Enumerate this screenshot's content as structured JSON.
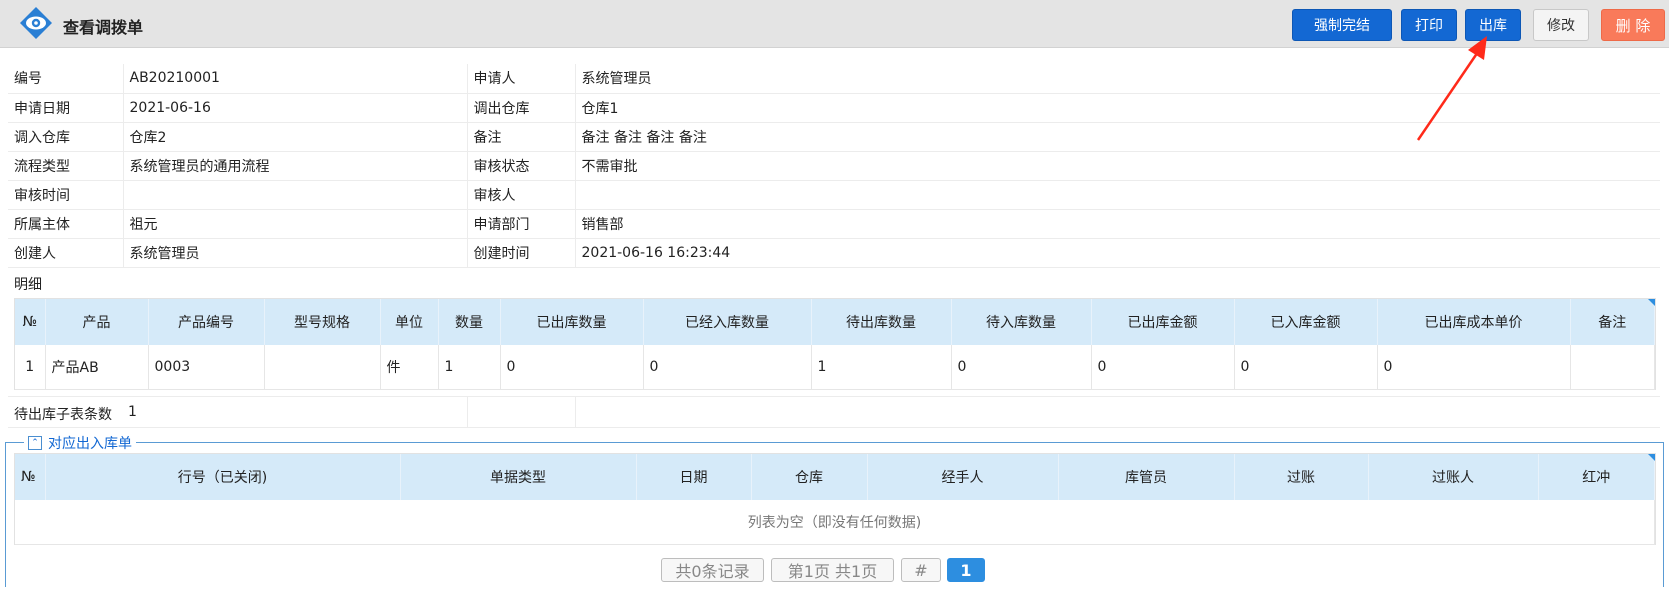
{
  "header": {
    "title": "查看调拨单",
    "buttons": {
      "force_complete": "强制完结",
      "print": "打印",
      "outbound": "出库",
      "modify": "修改",
      "delete": "删 除"
    }
  },
  "form": {
    "rows": [
      {
        "l1": "编号",
        "v1": "AB20210001",
        "l2": "申请人",
        "v2": "系统管理员"
      },
      {
        "l1": "申请日期",
        "v1": "2021-06-16",
        "l2": "调出仓库",
        "v2": "仓库1"
      },
      {
        "l1": "调入仓库",
        "v1": "仓库2",
        "l2": "备注",
        "v2": "备注 备注 备注 备注"
      },
      {
        "l1": "流程类型",
        "v1": "系统管理员的通用流程",
        "l2": "审核状态",
        "v2": "不需审批"
      },
      {
        "l1": "审核时间",
        "v1": "",
        "l2": "审核人",
        "v2": ""
      },
      {
        "l1": "所属主体",
        "v1": "祖元",
        "l2": "申请部门",
        "v2": "销售部"
      },
      {
        "l1": "创建人",
        "v1": "系统管理员",
        "l2": "创建时间",
        "v2": "2021-06-16 16:23:44"
      }
    ]
  },
  "detail": {
    "label": "明细",
    "columns": [
      "№",
      "产品",
      "产品编号",
      "型号规格",
      "单位",
      "数量",
      "已出库数量",
      "已经入库数量",
      "待出库数量",
      "待入库数量",
      "已出库金额",
      "已入库金额",
      "已出库成本单价",
      "备注"
    ],
    "rows": [
      [
        "1",
        "产品AB",
        "0003",
        "",
        "件",
        "1",
        "0",
        "0",
        "1",
        "0",
        "0",
        "0",
        "0",
        ""
      ]
    ]
  },
  "subcount": {
    "label": "待出库子表条数",
    "value": "1"
  },
  "related": {
    "legend": "对应出入库单",
    "columns": [
      "№",
      "行号（已关闭)",
      "单据类型",
      "日期",
      "仓库",
      "经手人",
      "库管员",
      "过账",
      "过账人",
      "红冲"
    ],
    "empty_text": "列表为空（即没有任何数据)"
  },
  "pager": {
    "records": "共0条记录",
    "pages": "第1页 共1页",
    "hash": "#",
    "current": "1"
  },
  "colors": {
    "primary": "#1368d3",
    "delete": "#f97a5a",
    "grid_header": "#d5eaf9",
    "arrow": "#ff2a1a"
  },
  "icons": {
    "logo": "eye-icon",
    "collapse": "double-chevron-up-icon"
  }
}
